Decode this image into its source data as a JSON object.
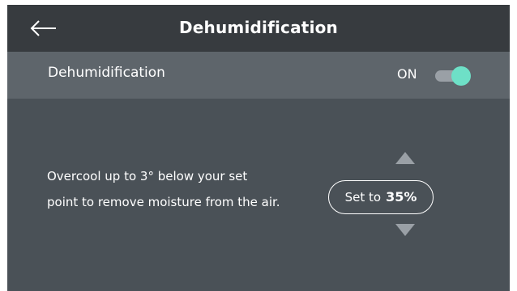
{
  "header": {
    "title": "Dehumidification",
    "back_icon": "arrow-left-icon"
  },
  "toggle": {
    "label": "Dehumidification",
    "state_label": "ON",
    "enabled": true,
    "knob_color": "#6ee0c7"
  },
  "description": {
    "line1": "Overcool up to 3° below your set",
    "line2": "point to remove moisture from the air."
  },
  "setpoint": {
    "prefix": "Set to",
    "value": "35%",
    "increase_icon": "triangle-up-icon",
    "decrease_icon": "triangle-down-icon"
  }
}
